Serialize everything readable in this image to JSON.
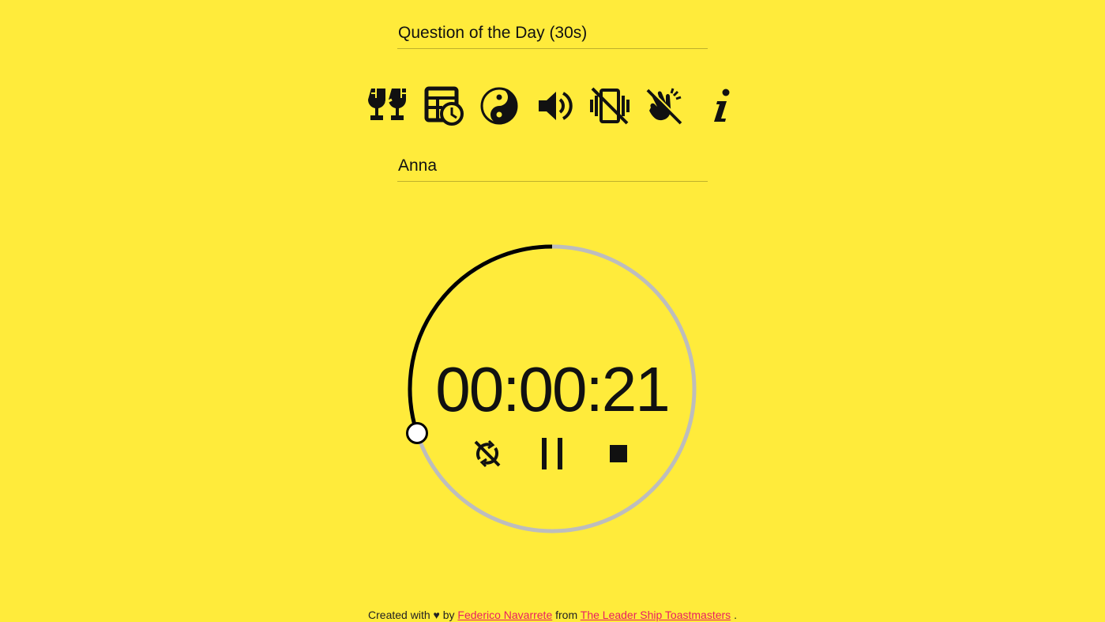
{
  "speech": {
    "title_value": "Question of the Day (30s)"
  },
  "toolbar": {
    "icons": [
      "trophy-broken-icon",
      "table-clock-icon",
      "yin-yang-icon",
      "volume-icon",
      "vibrate-off-icon",
      "clap-off-icon",
      "info-icon"
    ]
  },
  "speaker": {
    "name_value": "Anna"
  },
  "timer": {
    "hours": "00",
    "sep1": ":",
    "minutes": "00",
    "sep2": ":",
    "seconds": "21",
    "progress_fraction": 0.3,
    "track_color": "#bdbdbd",
    "progress_color": "#000000"
  },
  "controls": {
    "icons": [
      "sync-off-icon",
      "pause-icon",
      "stop-icon"
    ]
  },
  "footer": {
    "prefix": "Created with ♥ by",
    "author_link": "Federico Navarrete",
    "middle": "from",
    "club_link": "The Leader Ship Toastmasters",
    "suffix": "."
  },
  "colors": {
    "background": "#ffeb3b",
    "link": "#e91e63"
  }
}
